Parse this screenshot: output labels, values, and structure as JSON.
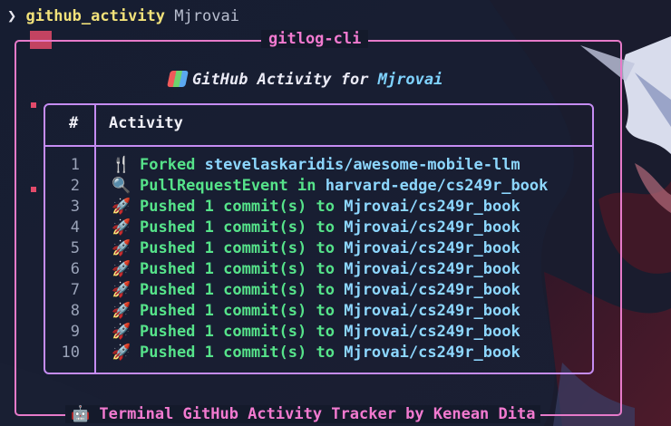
{
  "prompt": {
    "chevron": "❯",
    "command": "github_activity",
    "argument": "Mjrovai"
  },
  "panel": {
    "title": "gitlog-cli",
    "footer_emoji": "🤖",
    "footer_text": "Terminal GitHub Activity Tracker by Kenean Dita"
  },
  "heading": {
    "prefix": "GitHub Activity for",
    "user": "Mjrovai"
  },
  "table": {
    "header_num": "#",
    "header_activity": "Activity",
    "rows": [
      {
        "num": "1",
        "icon": "fork-and-knife-icon",
        "glyph": "🍴",
        "action": "Forked",
        "connector": "",
        "repo": "stevelaskaridis/awesome-mobile-llm"
      },
      {
        "num": "2",
        "icon": "magnifier-icon",
        "glyph": "🔍",
        "action": "PullRequestEvent",
        "connector": "in",
        "repo": "harvard-edge/cs249r_book"
      },
      {
        "num": "3",
        "icon": "rocket-icon",
        "glyph": "🚀",
        "action": "Pushed 1 commit(s)",
        "connector": "to",
        "repo": "Mjrovai/cs249r_book"
      },
      {
        "num": "4",
        "icon": "rocket-icon",
        "glyph": "🚀",
        "action": "Pushed 1 commit(s)",
        "connector": "to",
        "repo": "Mjrovai/cs249r_book"
      },
      {
        "num": "5",
        "icon": "rocket-icon",
        "glyph": "🚀",
        "action": "Pushed 1 commit(s)",
        "connector": "to",
        "repo": "Mjrovai/cs249r_book"
      },
      {
        "num": "6",
        "icon": "rocket-icon",
        "glyph": "🚀",
        "action": "Pushed 1 commit(s)",
        "connector": "to",
        "repo": "Mjrovai/cs249r_book"
      },
      {
        "num": "7",
        "icon": "rocket-icon",
        "glyph": "🚀",
        "action": "Pushed 1 commit(s)",
        "connector": "to",
        "repo": "Mjrovai/cs249r_book"
      },
      {
        "num": "8",
        "icon": "rocket-icon",
        "glyph": "🚀",
        "action": "Pushed 1 commit(s)",
        "connector": "to",
        "repo": "Mjrovai/cs249r_book"
      },
      {
        "num": "9",
        "icon": "rocket-icon",
        "glyph": "🚀",
        "action": "Pushed 1 commit(s)",
        "connector": "to",
        "repo": "Mjrovai/cs249r_book"
      },
      {
        "num": "10",
        "icon": "rocket-icon",
        "glyph": "🚀",
        "action": "Pushed 1 commit(s)",
        "connector": "to",
        "repo": "Mjrovai/cs249r_book"
      }
    ]
  },
  "colors": {
    "panel_border": "#e67ac9",
    "table_border": "#c58cf2",
    "action_green": "#56e38a",
    "repo_blue": "#8dd7ff",
    "command_yellow": "#f2e27a"
  }
}
